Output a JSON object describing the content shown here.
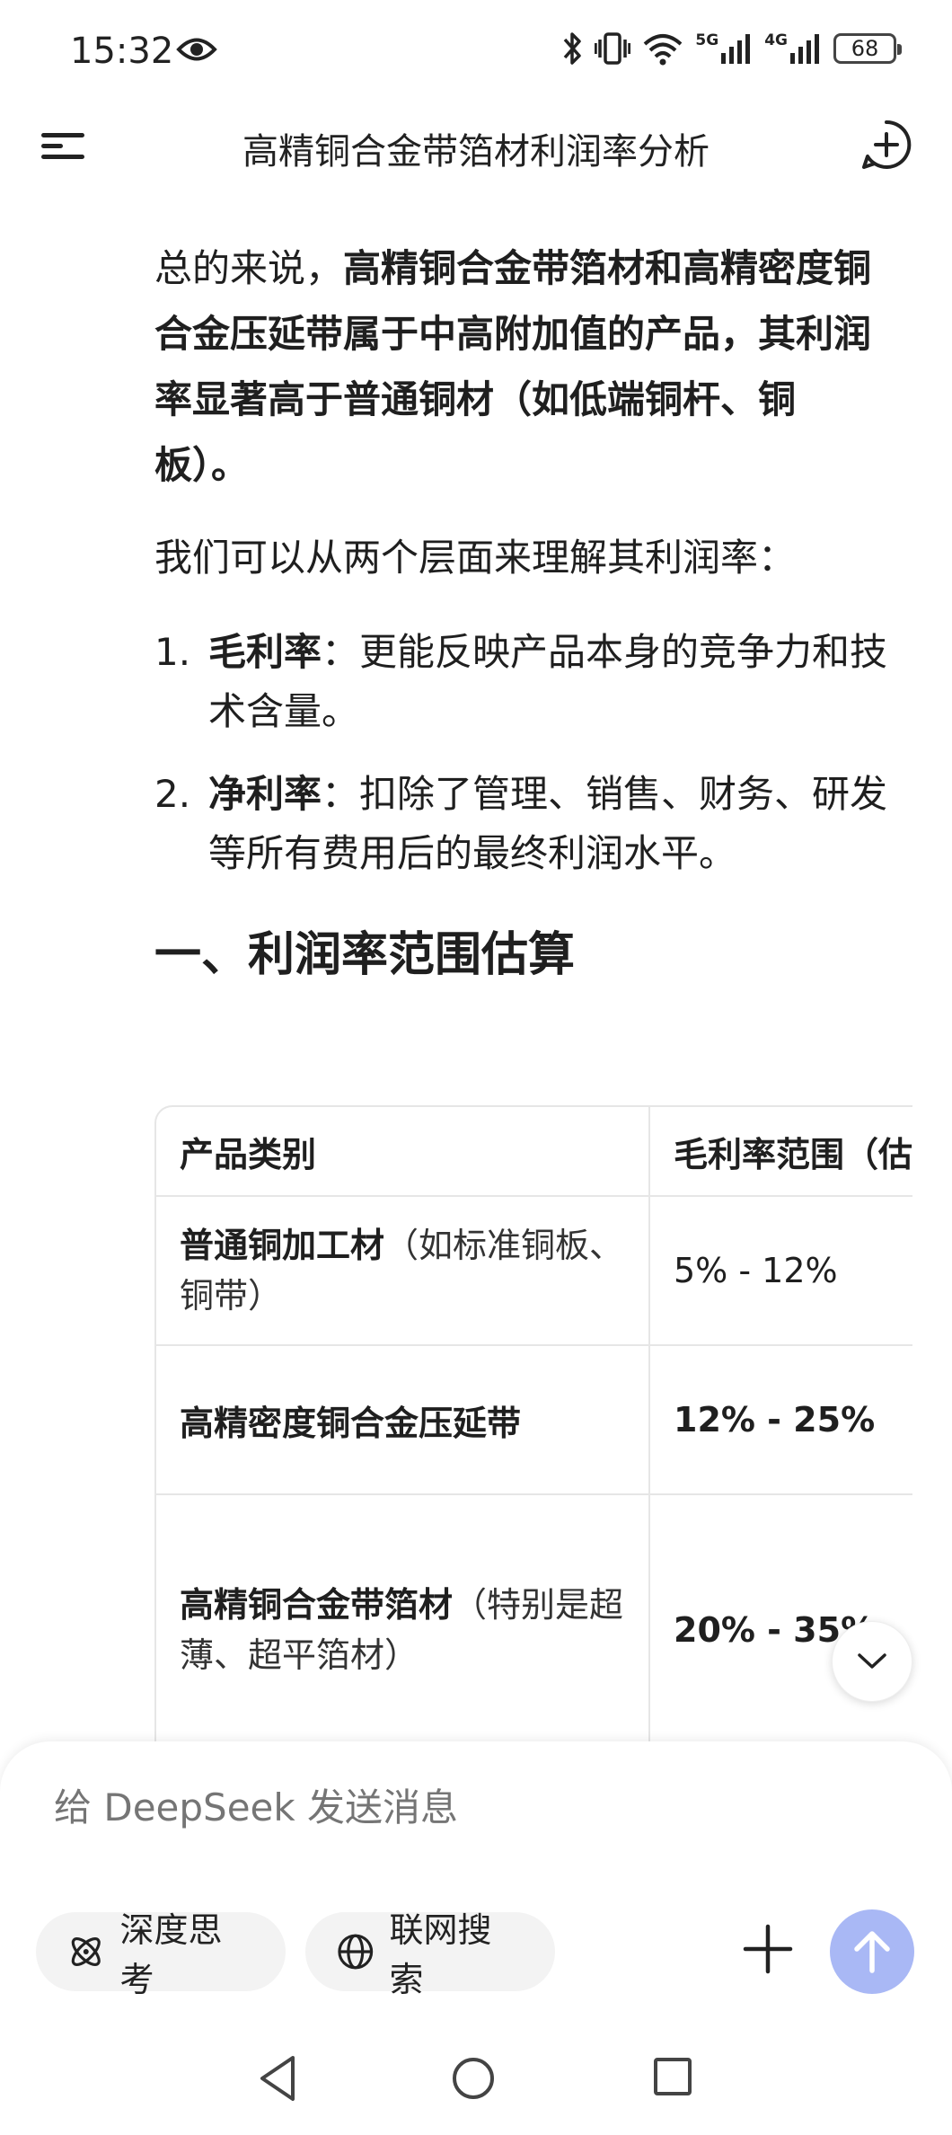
{
  "status_bar": {
    "time": "15:32",
    "signal_5g": "5G",
    "signal_4g": "4G",
    "battery": "68",
    "icons": [
      "eye-icon",
      "bluetooth-icon",
      "vibrate-icon",
      "wifi-icon",
      "signal-5g-icon",
      "signal-4g-icon",
      "battery-icon"
    ]
  },
  "header": {
    "title": "高精铜合金带箔材利润率分析",
    "menu_icon": "menu-icon",
    "new_chat_icon": "new-chat-icon"
  },
  "content": {
    "intro_prefix": "总的来说，",
    "intro_bold": "高精铜合金带箔材和高精密度铜合金压延带属于中高附加值的产品，其利润率显著高于普通铜材（如低端铜杆、铜板）。",
    "lead": "我们可以从两个层面来理解其利润率：",
    "list": [
      {
        "num": "1.",
        "term": "毛利率",
        "text": "：更能反映产品本身的竞争力和技术含量。"
      },
      {
        "num": "2.",
        "term": "净利率",
        "text": "：扣除了管理、销售、财务、研发等所有费用后的最终利润水平。"
      }
    ],
    "section_heading": "一、利润率范围估算"
  },
  "table": {
    "headers": [
      "产品类别",
      "毛利率范围（估"
    ],
    "rows": [
      {
        "name": "普通铜加工材",
        "note": "（如标准铜板、铜带）",
        "gross": "5% - 12%",
        "gross_bold": false
      },
      {
        "name": "高精密度铜合金压延带",
        "note": "",
        "gross": "12% - 25%",
        "gross_bold": true
      },
      {
        "name": "高精铜合金带箔材",
        "note": "（特别是超薄、超平箔材）",
        "gross": "20% - 35%",
        "gross_bold": true
      }
    ]
  },
  "composer": {
    "placeholder": "给 DeepSeek 发送消息",
    "deep_think_label": "深度思考",
    "web_search_label": "联网搜索"
  },
  "colors": {
    "send_button": "#a9b8f5",
    "chip_bg": "#f3f3f3",
    "border": "#e6e6e6",
    "placeholder": "#a9a9a9"
  }
}
